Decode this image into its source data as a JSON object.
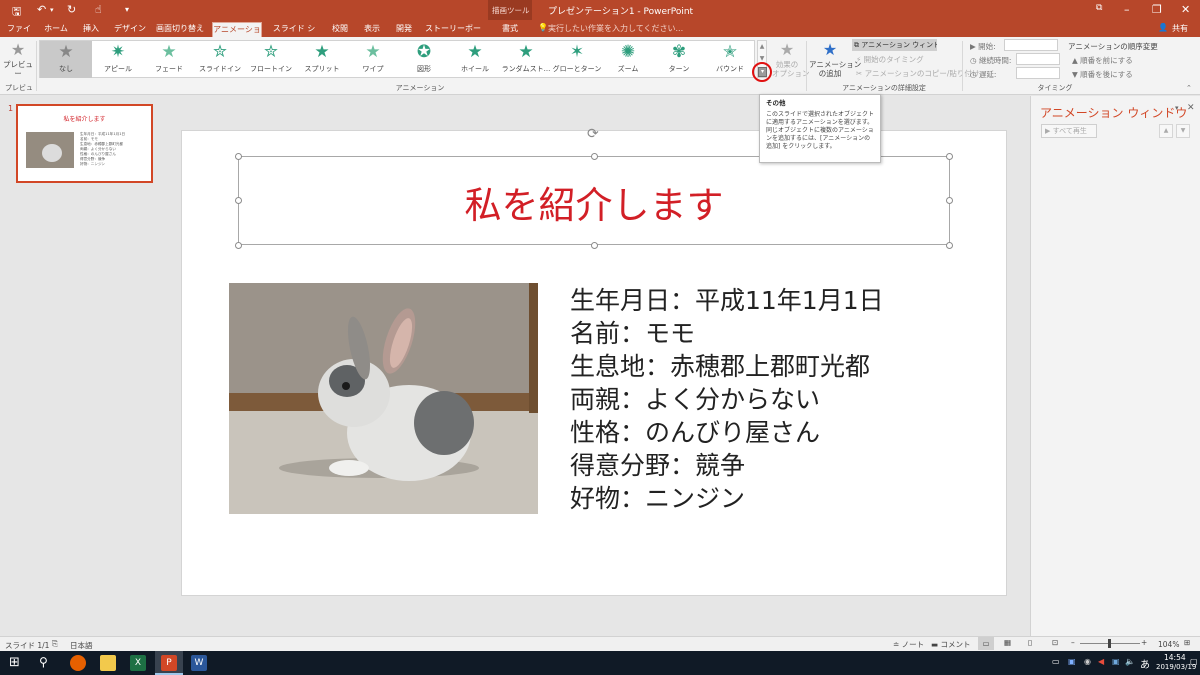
{
  "title_bar": {
    "drawing_tools": "描画ツール",
    "document_title": "プレゼンテーション1 - PowerPoint",
    "qat_icons": [
      "save-icon",
      "undo-icon",
      "redo-icon",
      "touch-mode-icon",
      "customize-qat-icon"
    ]
  },
  "tabs": [
    "ファイル",
    "ホーム",
    "挿入",
    "デザイン",
    "画面切り替え",
    "アニメーション",
    "スライド ショー",
    "校閲",
    "表示",
    "開発",
    "ストーリーボード"
  ],
  "active_tab": "アニメーション",
  "contextual_tab": "書式",
  "tell_me": "実行したい作業を入力してください...",
  "share": "共有",
  "ribbon": {
    "preview_label": "プレビュー",
    "preview_group": "プレビュー",
    "animation_gallery": [
      "なし",
      "アピール",
      "フェード",
      "スライドイン",
      "フロートイン",
      "スプリット",
      "ワイプ",
      "図形",
      "ホイール",
      "ランダムスト...",
      "グローとターン",
      "ズーム",
      "ターン",
      "バウンド"
    ],
    "selected_animation": "なし",
    "effect_options": "効果の\nオプション",
    "animation_group": "アニメーション",
    "add_animation": "アニメーション\nの追加",
    "animation_pane_btn": "アニメーション ウィンドウ",
    "trigger": "開始のタイミング",
    "animation_painter": "アニメーションのコピー/貼り付け",
    "advanced_group": "アニメーションの詳細設定",
    "start_label": "開始:",
    "duration_label": "継続時間:",
    "delay_label": "遅延:",
    "reorder_label": "アニメーションの順序変更",
    "move_earlier": "順番を前にする",
    "move_later": "順番を後にする",
    "timing_group": "タイミング"
  },
  "tooltip": {
    "title": "その他",
    "body": "このスライドで選択されたオブジェクトに適用するアニメーションを選びます。同じオブジェクトに複数のアニメーションを追加するには、[アニメーションの追加] をクリックします。"
  },
  "thumbnail": {
    "number": "1",
    "title": "私を紹介します",
    "lines": [
      "生年月日：平成11年1月1日",
      "名前：モモ",
      "生息地：赤穂郡上郡町光都",
      "両親：よく分からない",
      "性格：のんびり屋さん",
      "得意分野：競争",
      "好物：ニンジン"
    ]
  },
  "slide": {
    "title": "私を紹介します",
    "body": [
      "生年月日：平成11年1月1日",
      "名前：モモ",
      "生息地：赤穂郡上郡町光都",
      "両親：よく分からない",
      "性格：のんびり屋さん",
      "得意分野：競争",
      "好物：ニンジン"
    ]
  },
  "animation_pane": {
    "title": "アニメーション ウィンドウ",
    "play_all": "すべて再生"
  },
  "status": {
    "slide_info": "スライド 1/1",
    "language": "日本語",
    "notes": "ノート",
    "comments": "コメント",
    "zoom": "104%"
  },
  "taskbar": {
    "time": "14:54",
    "date": "2019/03/19",
    "ime": "あ"
  },
  "colors": {
    "accent": "#b7472a",
    "title_red": "#d21f26",
    "star_green": "#2e9e7d"
  }
}
